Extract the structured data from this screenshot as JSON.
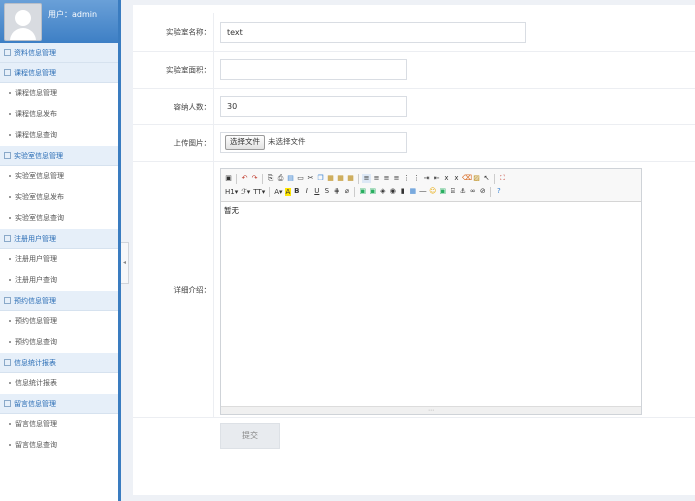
{
  "sidebar": {
    "user_label": "用户：admin",
    "groups": [
      {
        "title": "资料信息管理",
        "items": []
      },
      {
        "title": "课程信息管理",
        "items": [
          "课程信息管理",
          "课程信息发布",
          "课程信息查询"
        ]
      },
      {
        "title": "实验室信息管理",
        "items": [
          "实验室信息管理",
          "实验室信息发布",
          "实验室信息查询"
        ]
      },
      {
        "title": "注册用户管理",
        "items": [
          "注册用户管理",
          "注册用户查询"
        ]
      },
      {
        "title": "预约信息管理",
        "items": [
          "预约信息管理",
          "预约信息查询"
        ]
      },
      {
        "title": "信息统计报表",
        "items": [
          "信息统计报表"
        ]
      },
      {
        "title": "留言信息管理",
        "items": [
          "留言信息管理",
          "留言信息查询"
        ]
      }
    ]
  },
  "form": {
    "name_label": "实验室名称：",
    "name_value": "text",
    "area_label": "实验室面积：",
    "area_value": "",
    "capacity_label": "容纳人数：",
    "capacity_value": "30",
    "image_label": "上传图片：",
    "file_button": "选择文件",
    "file_status": "未选择文件",
    "detail_label": "详细介绍：",
    "editor_content": "暂无",
    "submit_label": "提交"
  }
}
